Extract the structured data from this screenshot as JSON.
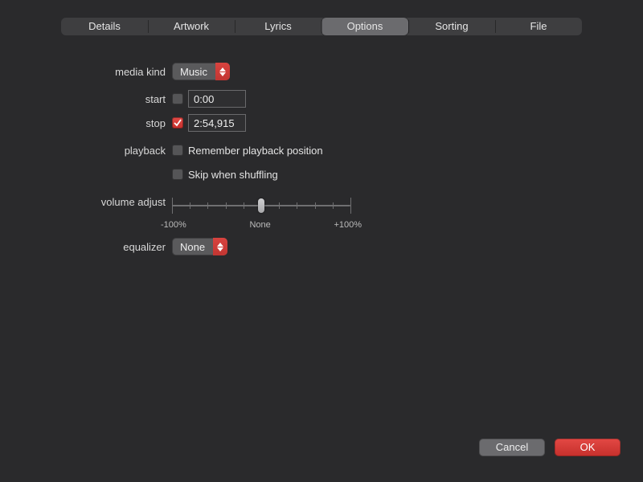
{
  "tabs": {
    "details": "Details",
    "artwork": "Artwork",
    "lyrics": "Lyrics",
    "options": "Options",
    "sorting": "Sorting",
    "file": "File"
  },
  "active_tab": "Options",
  "labels": {
    "media_kind": "media kind",
    "start": "start",
    "stop": "stop",
    "playback": "playback",
    "volume_adjust": "volume adjust",
    "equalizer": "equalizer"
  },
  "media_kind": {
    "value": "Music"
  },
  "start": {
    "checked": false,
    "value": "0:00"
  },
  "stop": {
    "checked": true,
    "value": "2:54,915"
  },
  "playback": {
    "remember_label": "Remember playback position",
    "remember_checked": false,
    "skip_label": "Skip when shuffling",
    "skip_checked": false
  },
  "volume_adjust": {
    "min_label": "-100%",
    "center_label": "None",
    "max_label": "+100%",
    "value_percent": 50
  },
  "equalizer": {
    "value": "None"
  },
  "buttons": {
    "cancel": "Cancel",
    "ok": "OK"
  }
}
